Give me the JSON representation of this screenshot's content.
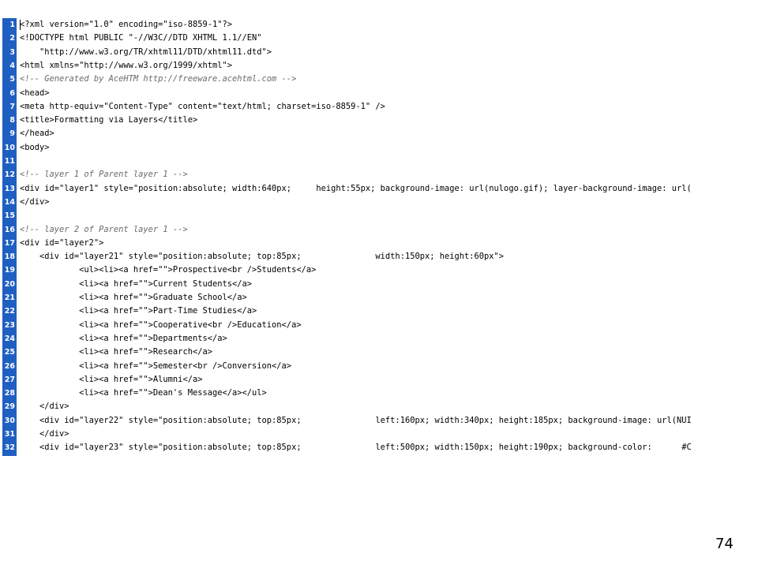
{
  "lines": [
    {
      "n": "1",
      "t": "<?xml version=\"1.0\" encoding=\"iso-8859-1\"?>",
      "c": false
    },
    {
      "n": "2",
      "t": "<!DOCTYPE html PUBLIC \"-//W3C//DTD XHTML 1.1//EN\"",
      "c": false
    },
    {
      "n": "3",
      "t": "    \"http://www.w3.org/TR/xhtml11/DTD/xhtml11.dtd\">",
      "c": false
    },
    {
      "n": "4",
      "t": "<html xmlns=\"http://www.w3.org/1999/xhtml\">",
      "c": false
    },
    {
      "n": "5",
      "t": "<!-- Generated by AceHTM http://freeware.acehtml.com -->",
      "c": true
    },
    {
      "n": "6",
      "t": "<head>",
      "c": false
    },
    {
      "n": "7",
      "t": "<meta http-equiv=\"Content-Type\" content=\"text/html; charset=iso-8859-1\" />",
      "c": false
    },
    {
      "n": "8",
      "t": "<title>Formatting via Layers</title>",
      "c": false
    },
    {
      "n": "9",
      "t": "</head>",
      "c": false
    },
    {
      "n": "10",
      "t": "<body>",
      "c": false
    },
    {
      "n": "11",
      "t": "",
      "c": false
    },
    {
      "n": "12",
      "t": "<!-- layer 1 of Parent layer 1 -->",
      "c": true
    },
    {
      "n": "13",
      "t": "<div id=\"layer1\" style=\"position:absolute; width:640px;     height:55px; background-image: url(nulogo.gif); layer-background-image: url(",
      "c": false
    },
    {
      "n": "14",
      "t": "</div>",
      "c": false
    },
    {
      "n": "15",
      "t": "",
      "c": false
    },
    {
      "n": "16",
      "t": "<!-- layer 2 of Parent layer 1 -->",
      "c": true
    },
    {
      "n": "17",
      "t": "<div id=\"layer2\">",
      "c": false
    },
    {
      "n": "18",
      "t": "    <div id=\"layer21\" style=\"position:absolute; top:85px;               width:150px; height:60px\">",
      "c": false
    },
    {
      "n": "19",
      "t": "            <ul><li><a href=\"\">Prospective<br />Students</a>",
      "c": false
    },
    {
      "n": "20",
      "t": "            <li><a href=\"\">Current Students</a>",
      "c": false
    },
    {
      "n": "21",
      "t": "            <li><a href=\"\">Graduate School</a>",
      "c": false
    },
    {
      "n": "22",
      "t": "            <li><a href=\"\">Part-Time Studies</a>",
      "c": false
    },
    {
      "n": "23",
      "t": "            <li><a href=\"\">Cooperative<br />Education</a>",
      "c": false
    },
    {
      "n": "24",
      "t": "            <li><a href=\"\">Departments</a>",
      "c": false
    },
    {
      "n": "25",
      "t": "            <li><a href=\"\">Research</a>",
      "c": false
    },
    {
      "n": "26",
      "t": "            <li><a href=\"\">Semester<br />Conversion</a>",
      "c": false
    },
    {
      "n": "27",
      "t": "            <li><a href=\"\">Alumni</a>",
      "c": false
    },
    {
      "n": "28",
      "t": "            <li><a href=\"\">Dean's Message</a></ul>",
      "c": false
    },
    {
      "n": "29",
      "t": "    </div>",
      "c": false
    },
    {
      "n": "30",
      "t": "    <div id=\"layer22\" style=\"position:absolute; top:85px;               left:160px; width:340px; height:185px; background-image: url(NUI",
      "c": false
    },
    {
      "n": "31",
      "t": "    </div>",
      "c": false
    },
    {
      "n": "32",
      "t": "    <div id=\"layer23\" style=\"position:absolute; top:85px;               left:500px; width:150px; height:190px; background-color:      #C",
      "c": false
    }
  ],
  "page_number": "74"
}
